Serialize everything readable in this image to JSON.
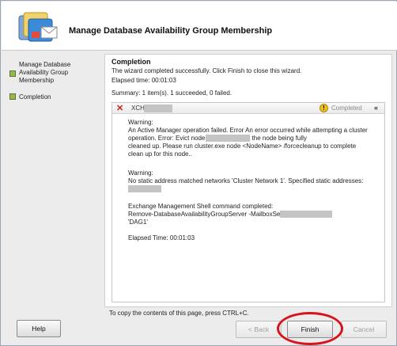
{
  "window": {
    "title": "Manage Database Availability Group Membership"
  },
  "steps": [
    {
      "label": "Manage Database Availability Group Membership"
    },
    {
      "label": "Completion"
    }
  ],
  "main": {
    "heading": "Completion",
    "message": "The wizard completed successfully. Click Finish to close this wizard.",
    "elapsed": "Elapsed time: 00:01:03",
    "summary": "Summary: 1 item(s). 1 succeeded, 0 failed."
  },
  "result": {
    "server": "XCH",
    "status": "Completed",
    "lines": [
      "Warning:",
      "An Active Manager operation failed. Error An error occurred while attempting a cluster",
      "operation. Error: Evict node                          eturned without the node being fully",
      "cleaned up. Please run cluster.exe node <NodeName> /forcecleanup to complete",
      "clean up for this node..",
      "",
      "Warning:",
      "No static address matched networks 'Cluster Network 1'. Specified static addresses:",
      "",
      "",
      "Exchange Management Shell command completed:",
      "Remove-DatabaseAvailabilityGroupServer -MailboxServer                            -Identity",
      "'DAG1'",
      "",
      "Elapsed Time: 00:01:03"
    ]
  },
  "footer": {
    "copy_hint": "To copy the contents of this page, press CTRL+C.",
    "help": "Help",
    "back": "< Back",
    "finish": "Finish",
    "cancel": "Cancel"
  }
}
